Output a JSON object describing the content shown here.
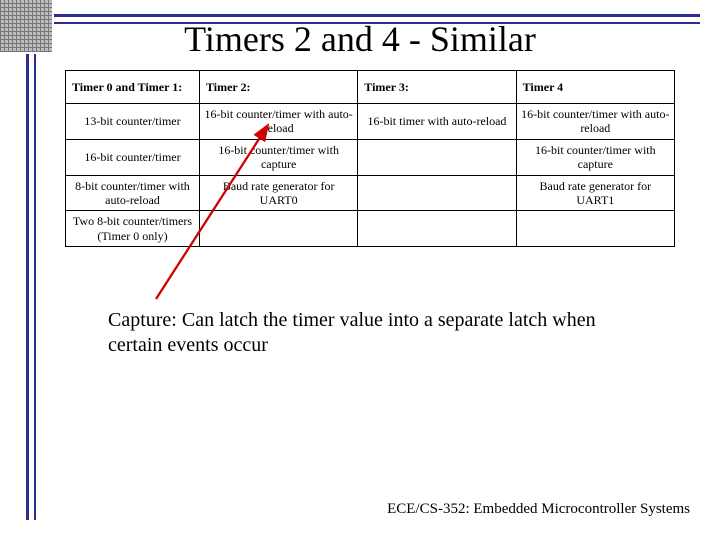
{
  "title": "Timers 2 and 4 - Similar",
  "table": {
    "headers": [
      "Timer 0 and Timer 1:",
      "Timer 2:",
      "Timer 3:",
      "Timer 4"
    ],
    "rows": [
      [
        "13-bit counter/timer",
        "16-bit counter/timer with auto-reload",
        "16-bit timer with auto-reload",
        "16-bit counter/timer with auto-reload"
      ],
      [
        "16-bit counter/timer",
        "16-bit counter/timer with capture",
        "",
        "16-bit counter/timer with capture"
      ],
      [
        "8-bit counter/timer with auto-reload",
        "Baud rate generator for UART0",
        "",
        "Baud rate generator for UART1"
      ],
      [
        "Two 8-bit counter/timers (Timer 0 only)",
        "",
        "",
        ""
      ]
    ]
  },
  "caption": "Capture: Can latch the timer value into a separate latch when certain events occur",
  "footer": "ECE/CS-352: Embedded Microcontroller Systems"
}
